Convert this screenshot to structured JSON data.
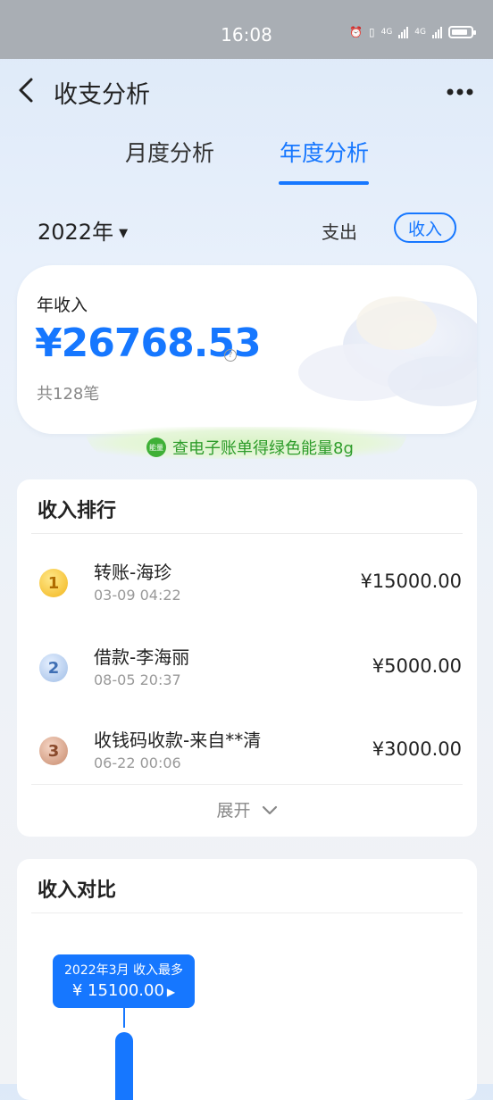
{
  "status_bar": {
    "time": "16:08",
    "network_labels": [
      "4G",
      "4G"
    ]
  },
  "header": {
    "back_icon": "chevron-left-icon",
    "title": "收支分析",
    "more_icon": "more-dots-icon"
  },
  "tabs": [
    {
      "label": "月度分析",
      "active": false
    },
    {
      "label": "年度分析",
      "active": true
    }
  ],
  "filter": {
    "year": "2022年",
    "expense_label": "支出",
    "income_label": "收入",
    "selected": "收入"
  },
  "summary": {
    "label": "年收入",
    "amount": "¥26768.53",
    "count": "共128笔"
  },
  "energy": {
    "badge": "能量",
    "text": "查电子账单得绿色能量8g"
  },
  "ranking": {
    "title": "收入排行",
    "items": [
      {
        "rank": "1",
        "name": "转账-海珍",
        "time": "03-09 04:22",
        "amount": "¥15000.00"
      },
      {
        "rank": "2",
        "name": "借款-李海丽",
        "time": "08-05 20:37",
        "amount": "¥5000.00"
      },
      {
        "rank": "3",
        "name": "收钱码收款-来自**清",
        "time": "06-22 00:06",
        "amount": "¥3000.00"
      }
    ],
    "expand_label": "展开"
  },
  "comparison": {
    "title": "收入对比",
    "tooltip_line1": "2022年3月 收入最多",
    "tooltip_line2": "¥ 15100.00"
  },
  "colors": {
    "accent": "#1677ff",
    "energy_green": "#3fb037"
  }
}
